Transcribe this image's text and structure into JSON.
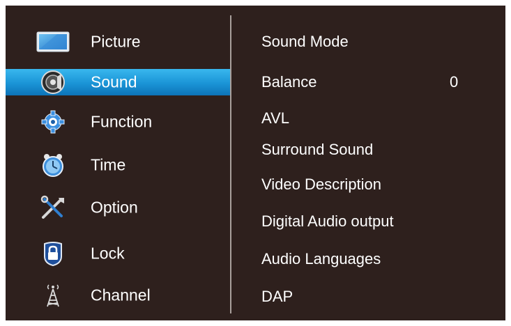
{
  "menu": {
    "items": [
      {
        "label": "Picture",
        "icon": "picture-icon",
        "selected": false
      },
      {
        "label": "Sound",
        "icon": "speaker-icon",
        "selected": true
      },
      {
        "label": "Function",
        "icon": "gear-icon",
        "selected": false
      },
      {
        "label": "Time",
        "icon": "clock-icon",
        "selected": false
      },
      {
        "label": "Option",
        "icon": "tools-icon",
        "selected": false
      },
      {
        "label": "Lock",
        "icon": "lock-icon",
        "selected": false
      },
      {
        "label": "Channel",
        "icon": "antenna-icon",
        "selected": false
      }
    ]
  },
  "sound_settings": {
    "items": [
      {
        "label": "Sound Mode",
        "value": ""
      },
      {
        "label": "Balance",
        "value": "0"
      },
      {
        "label": "AVL",
        "value": ""
      },
      {
        "label": "Surround Sound",
        "value": ""
      },
      {
        "label": "Video Description",
        "value": ""
      },
      {
        "label": "Digital Audio output",
        "value": ""
      },
      {
        "label": "Audio Languages",
        "value": ""
      },
      {
        "label": "DAP",
        "value": ""
      }
    ]
  },
  "colors": {
    "background": "#2e201d",
    "selection": "#1a94d6",
    "text": "#ffffff"
  }
}
